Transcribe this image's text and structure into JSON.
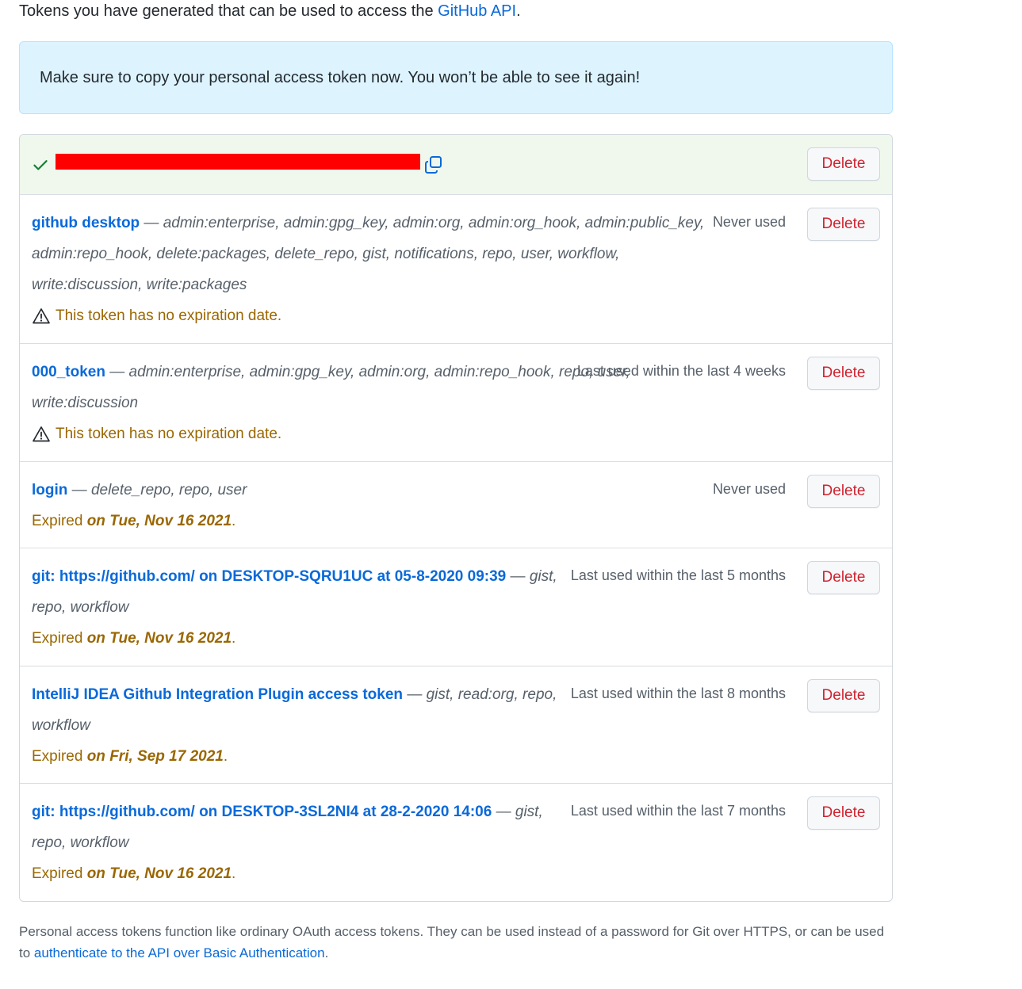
{
  "intro": {
    "text": "Tokens you have generated that can be used to access the ",
    "link": "GitHub API",
    "suffix": "."
  },
  "flash": {
    "message": "Make sure to copy your personal access token now. You won’t be able to see it again!"
  },
  "new_token": {
    "delete_label": "Delete"
  },
  "tokens": [
    {
      "name": "github desktop",
      "scopes": "admin:enterprise, admin:gpg_key, admin:org, admin:org_hook, admin:public_key, admin:repo_hook, delete:packages, delete_repo, gist, notifications, repo, user, workflow, write:discussion, write:packages",
      "usage": "Never used",
      "warning": "This token has no expiration date.",
      "delete_label": "Delete"
    },
    {
      "name": "000_token",
      "scopes": "admin:enterprise, admin:gpg_key, admin:org, admin:repo_hook, repo, user, write:discussion",
      "usage": "Last used within the last 4 weeks",
      "warning": "This token has no expiration date.",
      "delete_label": "Delete"
    },
    {
      "name": "login",
      "scopes": "delete_repo, repo, user",
      "usage": "Never used",
      "expired_prefix": "Expired ",
      "expired_date": "on Tue, Nov 16 2021",
      "delete_label": "Delete"
    },
    {
      "name": "git: https://github.com/ on DESKTOP-SQRU1UC at 05-8-2020 09:39",
      "scopes": "gist, repo, workflow",
      "usage": "Last used within the last 5 months",
      "expired_prefix": "Expired ",
      "expired_date": "on Tue, Nov 16 2021",
      "delete_label": "Delete"
    },
    {
      "name": "IntelliJ IDEA Github Integration Plugin access token",
      "scopes": "gist, read:org, repo, workflow",
      "usage": "Last used within the last 8 months",
      "expired_prefix": "Expired ",
      "expired_date": "on Fri, Sep 17 2021",
      "delete_label": "Delete"
    },
    {
      "name": "git: https://github.com/ on DESKTOP-3SL2NI4 at 28-2-2020 14:06",
      "scopes": "gist, repo, workflow",
      "usage": "Last used within the last 7 months",
      "expired_prefix": "Expired ",
      "expired_date": "on Tue, Nov 16 2021",
      "delete_label": "Delete"
    }
  ],
  "separator": " — ",
  "footnote": {
    "text": "Personal access tokens function like ordinary OAuth access tokens. They can be used instead of a password for Git over HTTPS, or can be used to ",
    "link": "authenticate to the API over Basic Authentication",
    "suffix": "."
  }
}
